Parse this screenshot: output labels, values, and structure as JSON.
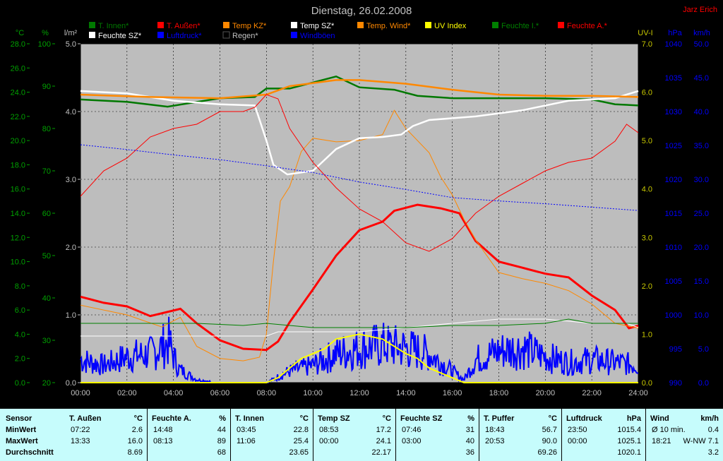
{
  "header": {
    "date": "Dienstag, 26.02.2008",
    "author": "Jarz Erich"
  },
  "colors": {
    "innen": "#007800",
    "aussen": "#ff0000",
    "kz": "#ff8800",
    "sz": "#ffffff",
    "wind_t": "#ff8800",
    "uv": "#ffff00",
    "feuchte_i": "#008000",
    "feuchte_a": "#ff0000",
    "feuchte_sz": "#ffffff",
    "luft": "#0000ff",
    "regen": "#000000",
    "boeen": "#0000cc"
  },
  "legend": [
    {
      "label": "T. Innen*",
      "color": "#007800"
    },
    {
      "label": "T. Außen*",
      "color": "#ff0000"
    },
    {
      "label": "Temp KZ*",
      "color": "#ff8800"
    },
    {
      "label": "Temp SZ*",
      "color": "#ffffff"
    },
    {
      "label": "Temp. Wind*",
      "color": "#ff8800"
    },
    {
      "label": "UV Index",
      "color": "#ffff00"
    },
    {
      "label": "Feuchte I.*",
      "color": "#008000"
    },
    {
      "label": "Feuchte A.*",
      "color": "#ff0000"
    },
    {
      "label": "Feuchte SZ*",
      "color": "#ffffff"
    },
    {
      "label": "Luftdruck*",
      "color": "#0000ff"
    },
    {
      "label": "Regen*",
      "color": "#000000"
    },
    {
      "label": "Windböen",
      "color": "#0000ff"
    }
  ],
  "chart_data": {
    "type": "line",
    "title": "Dienstag, 26.02.2008",
    "x_ticks": [
      "00:00",
      "02:00",
      "04:00",
      "06:00",
      "08:00",
      "10:00",
      "12:00",
      "14:00",
      "16:00",
      "18:00",
      "20:00",
      "22:00",
      "24:00"
    ],
    "axes": {
      "temp": {
        "unit": "°C",
        "min": 0,
        "max": 28,
        "ticks": [
          "0.0",
          "2.0",
          "4.0",
          "6.0",
          "8.0",
          "10.0",
          "12.0",
          "14.0",
          "16.0",
          "18.0",
          "20.0",
          "22.0",
          "24.0",
          "26.0",
          "28.0"
        ]
      },
      "humidity": {
        "unit": "%",
        "min": 20,
        "max": 100,
        "ticks": [
          "20",
          "30",
          "40",
          "50",
          "60",
          "70",
          "80",
          "90",
          "100"
        ]
      },
      "rain": {
        "unit": "l/m²",
        "min": 0,
        "max": 5,
        "ticks": [
          "0.0",
          "1.0",
          "2.0",
          "3.0",
          "4.0",
          "5.0"
        ]
      },
      "uv": {
        "unit": "UV-I",
        "min": 0,
        "max": 7,
        "ticks": [
          "0.0",
          "1.0",
          "2.0",
          "3.0",
          "4.0",
          "5.0",
          "6.0",
          "7.0"
        ]
      },
      "pressure": {
        "unit": "hPa",
        "min": 990,
        "max": 1040,
        "ticks": [
          "990",
          "995",
          "1000",
          "1005",
          "1010",
          "1015",
          "1020",
          "1025",
          "1030",
          "1035",
          "1040"
        ]
      },
      "wind": {
        "unit": "km/h",
        "min": 0,
        "max": 50,
        "ticks": [
          "0.0",
          "5.0",
          "10.0",
          "15.0",
          "20.0",
          "25.0",
          "30.0",
          "35.0",
          "40.0",
          "45.0",
          "50.0"
        ]
      }
    },
    "series": [
      {
        "name": "T. Innen*",
        "axis": "temp",
        "color": "#007800",
        "width": 2.5,
        "points": [
          [
            0,
            23.4
          ],
          [
            2,
            23.2
          ],
          [
            3.75,
            22.8
          ],
          [
            6,
            23.5
          ],
          [
            7.5,
            23.6
          ],
          [
            8,
            24.3
          ],
          [
            9,
            24.3
          ],
          [
            11,
            25.3
          ],
          [
            12,
            24.4
          ],
          [
            13.5,
            24.2
          ],
          [
            14.5,
            23.7
          ],
          [
            16,
            23.5
          ],
          [
            20,
            23.5
          ],
          [
            22,
            23.4
          ],
          [
            23,
            23.0
          ],
          [
            24,
            22.9
          ]
        ]
      },
      {
        "name": "T. Außen*",
        "axis": "temp",
        "color": "#ff0000",
        "width": 3,
        "points": [
          [
            0,
            7.1
          ],
          [
            1,
            6.6
          ],
          [
            2,
            6.3
          ],
          [
            3,
            5.5
          ],
          [
            4.3,
            6.1
          ],
          [
            5,
            4.9
          ],
          [
            6,
            3.5
          ],
          [
            7,
            2.8
          ],
          [
            8,
            2.7
          ],
          [
            8.5,
            3.4
          ],
          [
            9,
            5.0
          ],
          [
            10,
            7.7
          ],
          [
            11,
            10.5
          ],
          [
            12,
            12.6
          ],
          [
            13,
            13.3
          ],
          [
            13.5,
            14.2
          ],
          [
            14.5,
            14.7
          ],
          [
            15.5,
            14.4
          ],
          [
            16.3,
            14.0
          ],
          [
            17,
            11.7
          ],
          [
            18,
            10.0
          ],
          [
            19,
            9.5
          ],
          [
            20,
            9.0
          ],
          [
            21,
            8.7
          ],
          [
            22,
            7.2
          ],
          [
            23,
            6.0
          ],
          [
            23.6,
            4.5
          ],
          [
            24,
            4.7
          ]
        ]
      },
      {
        "name": "Temp KZ*",
        "axis": "temp",
        "color": "#ff8800",
        "width": 1,
        "points": [
          [
            0,
            6.4
          ],
          [
            2,
            5.6
          ],
          [
            3.5,
            4.6
          ],
          [
            4.3,
            5.4
          ],
          [
            5,
            3.0
          ],
          [
            6,
            2.0
          ],
          [
            7,
            1.8
          ],
          [
            7.7,
            2.1
          ],
          [
            8,
            4.0
          ],
          [
            8.3,
            10.0
          ],
          [
            8.6,
            15.0
          ],
          [
            9,
            16.2
          ],
          [
            9.5,
            19.1
          ],
          [
            10,
            20.2
          ],
          [
            11,
            19.9
          ],
          [
            12,
            20.0
          ],
          [
            13,
            20.5
          ],
          [
            13.5,
            22.5
          ],
          [
            14,
            21.0
          ],
          [
            15,
            19.0
          ],
          [
            15.5,
            17.0
          ],
          [
            16,
            15.5
          ],
          [
            16.5,
            13.5
          ],
          [
            17,
            11.8
          ],
          [
            18,
            9.1
          ],
          [
            19,
            8.6
          ],
          [
            20,
            8.2
          ],
          [
            21,
            7.6
          ],
          [
            22,
            6.5
          ],
          [
            23,
            4.9
          ],
          [
            24,
            4.5
          ]
        ]
      },
      {
        "name": "Temp SZ*",
        "axis": "temp",
        "color": "#ffffff",
        "width": 2.5,
        "points": [
          [
            0,
            24.1
          ],
          [
            2,
            23.9
          ],
          [
            4,
            23.3
          ],
          [
            6,
            23.0
          ],
          [
            7.5,
            22.9
          ],
          [
            8,
            20.0
          ],
          [
            8.3,
            18.0
          ],
          [
            8.9,
            17.2
          ],
          [
            10,
            17.5
          ],
          [
            11,
            19.3
          ],
          [
            12,
            20.2
          ],
          [
            13,
            20.3
          ],
          [
            13.8,
            20.5
          ],
          [
            14.3,
            21.2
          ],
          [
            15,
            21.7
          ],
          [
            17,
            22.0
          ],
          [
            19,
            22.5
          ],
          [
            21,
            23.3
          ],
          [
            23,
            23.5
          ],
          [
            24,
            24.1
          ]
        ]
      },
      {
        "name": "Temp. Wind*",
        "axis": "temp",
        "color": "#ff8800",
        "width": 2.5,
        "points": [
          [
            0,
            23.8
          ],
          [
            3,
            23.6
          ],
          [
            6,
            23.5
          ],
          [
            8,
            23.8
          ],
          [
            9,
            24.5
          ],
          [
            11,
            25.0
          ],
          [
            12,
            25.0
          ],
          [
            14,
            24.7
          ],
          [
            16,
            24.2
          ],
          [
            18,
            23.8
          ],
          [
            20,
            23.7
          ],
          [
            22,
            23.7
          ],
          [
            24,
            23.6
          ]
        ]
      },
      {
        "name": "Feuchte A.*",
        "axis": "humidity",
        "color": "#ff0000",
        "width": 1,
        "points": [
          [
            0,
            64
          ],
          [
            1,
            70
          ],
          [
            2,
            73
          ],
          [
            3,
            78
          ],
          [
            4,
            80
          ],
          [
            5,
            81
          ],
          [
            6,
            84
          ],
          [
            7,
            84
          ],
          [
            7.5,
            85
          ],
          [
            8,
            88
          ],
          [
            8.5,
            87
          ],
          [
            9,
            80
          ],
          [
            10,
            72
          ],
          [
            11,
            66
          ],
          [
            12,
            61
          ],
          [
            13,
            58
          ],
          [
            14,
            53
          ],
          [
            15,
            51
          ],
          [
            16,
            54
          ],
          [
            17,
            60
          ],
          [
            18,
            64
          ],
          [
            19,
            67
          ],
          [
            20,
            70
          ],
          [
            21,
            72
          ],
          [
            22,
            73
          ],
          [
            23,
            77
          ],
          [
            23.5,
            81
          ],
          [
            24,
            79
          ]
        ]
      },
      {
        "name": "Feuchte SZ*",
        "axis": "humidity",
        "color": "#ffffff",
        "width": 1,
        "points": [
          [
            0,
            31
          ],
          [
            3,
            31
          ],
          [
            7,
            31
          ],
          [
            8,
            31
          ],
          [
            8.5,
            32
          ],
          [
            10,
            32
          ],
          [
            12,
            32
          ],
          [
            14,
            33
          ],
          [
            16,
            34
          ],
          [
            18,
            35
          ],
          [
            20,
            35
          ],
          [
            22,
            34
          ],
          [
            23.5,
            34
          ],
          [
            24,
            33
          ]
        ]
      },
      {
        "name": "Feuchte I.*",
        "axis": "humidity",
        "color": "#008000",
        "width": 1,
        "points": [
          [
            0,
            34
          ],
          [
            5,
            34
          ],
          [
            7,
            33.5
          ],
          [
            8,
            34
          ],
          [
            10,
            33
          ],
          [
            14,
            33
          ],
          [
            16,
            33.5
          ],
          [
            18,
            33.5
          ],
          [
            20,
            34
          ],
          [
            21,
            35
          ],
          [
            22,
            34
          ],
          [
            24,
            34
          ]
        ]
      },
      {
        "name": "Luftdruck*",
        "axis": "pressure",
        "color": "#0000ff",
        "width": 1,
        "dash": true,
        "points": [
          [
            0,
            1025.1
          ],
          [
            2,
            1024.4
          ],
          [
            4,
            1023.6
          ],
          [
            6,
            1022.9
          ],
          [
            8,
            1022.0
          ],
          [
            10,
            1021.0
          ],
          [
            12,
            1019.6
          ],
          [
            14,
            1018.5
          ],
          [
            16,
            1017.3
          ],
          [
            18,
            1016.8
          ],
          [
            20,
            1016.4
          ],
          [
            22,
            1015.9
          ],
          [
            24,
            1015.4
          ]
        ]
      }
    ],
    "uv_index": [
      [
        0,
        0
      ],
      [
        8,
        0
      ],
      [
        8.5,
        0.1
      ],
      [
        9,
        0.3
      ],
      [
        9.5,
        0.5
      ],
      [
        10,
        0.6
      ],
      [
        10.5,
        0.7
      ],
      [
        11,
        0.9
      ],
      [
        12,
        1.0
      ],
      [
        13,
        0.9
      ],
      [
        14,
        0.6
      ],
      [
        14.5,
        0.5
      ],
      [
        15,
        0.3
      ],
      [
        15.5,
        0.2
      ],
      [
        16,
        0.1
      ],
      [
        16.5,
        0
      ],
      [
        24,
        0
      ]
    ],
    "windboeen_profile": [
      [
        0,
        4.0
      ],
      [
        1,
        3.0
      ],
      [
        2,
        4.5
      ],
      [
        3,
        5.0
      ],
      [
        3.8,
        7.0
      ],
      [
        4.2,
        2.5
      ],
      [
        5,
        0.5
      ],
      [
        6,
        0
      ],
      [
        8,
        0
      ],
      [
        8.5,
        1.0
      ],
      [
        9,
        2.0
      ],
      [
        10,
        3.0
      ],
      [
        11,
        5.0
      ],
      [
        12,
        6.0
      ],
      [
        13,
        6.5
      ],
      [
        14,
        6.0
      ],
      [
        15,
        5.0
      ],
      [
        16,
        2.0
      ],
      [
        16.5,
        0.5
      ],
      [
        17,
        4.0
      ],
      [
        18,
        5.5
      ],
      [
        19,
        6.0
      ],
      [
        20,
        4.5
      ],
      [
        21,
        3.5
      ],
      [
        22,
        4.0
      ],
      [
        23,
        3.5
      ],
      [
        24,
        3.0
      ]
    ]
  },
  "stats": {
    "row_labels": [
      "Sensor",
      "MinWert",
      "MaxWert",
      "Durchschnitt"
    ],
    "columns": [
      {
        "name": "T. Außen",
        "unit": "°C",
        "min_time": "07:22",
        "min": "2.6",
        "max_time": "13:33",
        "max": "16.0",
        "avg": "8.69"
      },
      {
        "name": "Feuchte A.",
        "unit": "%",
        "min_time": "14:48",
        "min": "44",
        "max_time": "08:13",
        "max": "89",
        "avg": "68"
      },
      {
        "name": "T. Innen",
        "unit": "°C",
        "min_time": "03:45",
        "min": "22.8",
        "max_time": "11:06",
        "max": "25.4",
        "avg": "23.65"
      },
      {
        "name": "Temp SZ",
        "unit": "°C",
        "min_time": "08:53",
        "min": "17.2",
        "max_time": "00:00",
        "max": "24.1",
        "avg": "22.17"
      },
      {
        "name": "Feuchte SZ",
        "unit": "%",
        "min_time": "07:46",
        "min": "31",
        "max_time": "03:00",
        "max": "40",
        "avg": "36"
      },
      {
        "name": "T. Puffer",
        "unit": "°C",
        "min_time": "18:43",
        "min": "56.7",
        "max_time": "20:53",
        "max": "90.0",
        "avg": "69.26"
      },
      {
        "name": "Luftdruck",
        "unit": "hPa",
        "min_time": "23:50",
        "min": "1015.4",
        "max_time": "00:00",
        "max": "1025.1",
        "avg": "1020.1"
      },
      {
        "name": "Wind",
        "unit": "km/h",
        "min_time": "Ø 10 min.",
        "min": "0.4",
        "max_time": "18:21",
        "max": "W-NW 7.1",
        "avg": "3.2"
      }
    ]
  }
}
